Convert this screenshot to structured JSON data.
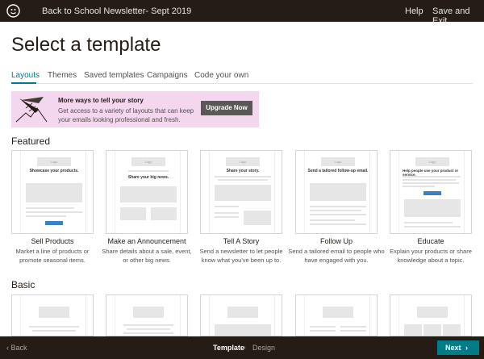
{
  "header": {
    "campaign_name": "Back to School Newsletter- Sept 2019",
    "help": "Help",
    "save_exit": "Save and Exit"
  },
  "page_title": "Select a template",
  "tabs": [
    {
      "label": "Layouts",
      "active": true
    },
    {
      "label": "Themes",
      "active": false
    },
    {
      "label": "Saved templates",
      "active": false
    },
    {
      "label": "Campaigns",
      "active": false
    },
    {
      "label": "Code your own",
      "active": false
    }
  ],
  "promo": {
    "title": "More ways to tell your story",
    "text": "Get access to a variety of layouts that can keep your emails looking professional and fresh.",
    "button": "Upgrade Now"
  },
  "sections": {
    "featured": "Featured",
    "basic": "Basic"
  },
  "featured": [
    {
      "name": "Sell Products",
      "description": "Market a line of products or promote seasonal items.",
      "preview_title": "Showcase your products.",
      "logo": "Logo"
    },
    {
      "name": "Make an Announcement",
      "description": "Share details about a sale, event, or other big news.",
      "preview_title": "Share your big news.",
      "logo": "Logo"
    },
    {
      "name": "Tell A Story",
      "description": "Send a newsletter to let people know what you've been up to.",
      "preview_title": "Share your story.",
      "logo": "Logo"
    },
    {
      "name": "Follow Up",
      "description": "Send a tailored email to people who have engaged with you.",
      "preview_title": "Send a tailored follow-up email.",
      "logo": "Logo"
    },
    {
      "name": "Educate",
      "description": "Explain your products or share knowledge about a topic.",
      "preview_title": "Help people use your product or service.",
      "logo": "Logo"
    }
  ],
  "footer": {
    "back": "Back",
    "step_current": "Template",
    "step_next": "Design",
    "next": "Next"
  },
  "colors": {
    "accent": "#007c89",
    "dark": "#241c15",
    "promo_bg": "#f4d7ef"
  }
}
